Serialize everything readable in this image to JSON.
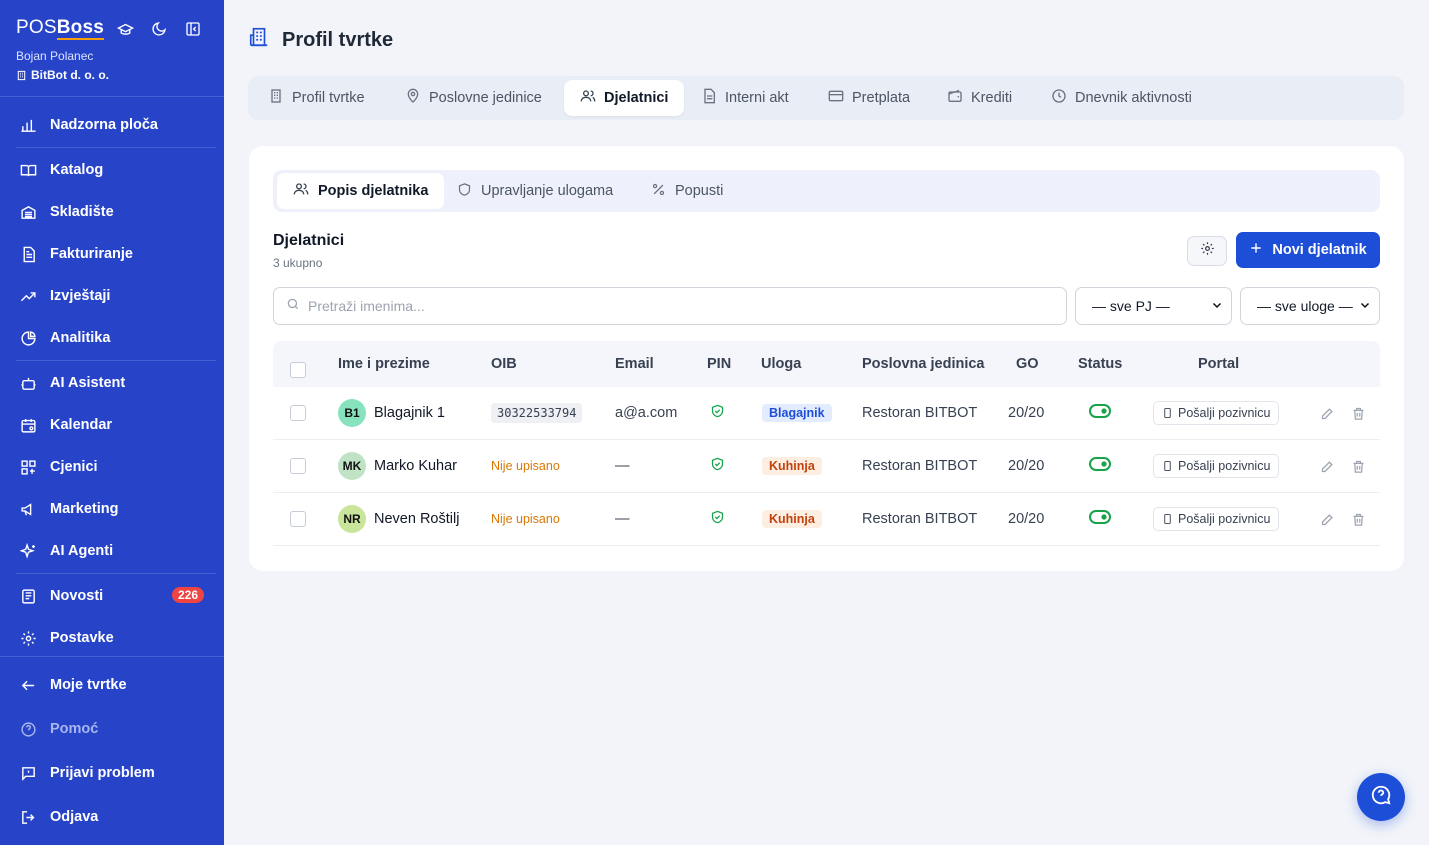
{
  "sidebar": {
    "brand_pos": "POS",
    "brand_boss": "Boss",
    "user_name": "Bojan Polanec",
    "company": "BitBot d. o. o.",
    "items": [
      {
        "label": "Nadzorna ploča",
        "icon": "chart-bars-icon"
      },
      {
        "label": "Katalog",
        "icon": "book-icon"
      },
      {
        "label": "Skladište",
        "icon": "warehouse-icon"
      },
      {
        "label": "Fakturiranje",
        "icon": "invoice-icon"
      },
      {
        "label": "Izvještaji",
        "icon": "trend-icon"
      },
      {
        "label": "Analitika",
        "icon": "pie-icon"
      },
      {
        "label": "AI Asistent",
        "icon": "robot-icon"
      },
      {
        "label": "Kalendar",
        "icon": "calendar-icon"
      },
      {
        "label": "Cjenici",
        "icon": "grid-icon"
      },
      {
        "label": "Marketing",
        "icon": "megaphone-icon"
      },
      {
        "label": "AI Agenti",
        "icon": "sparkles-icon"
      },
      {
        "label": "Novosti",
        "icon": "news-icon",
        "badge": "226"
      },
      {
        "label": "Postavke",
        "icon": "gear-icon"
      },
      {
        "label": "Moje tvrtke",
        "icon": "arrow-left-icon"
      },
      {
        "label": "Pomoć",
        "icon": "help-icon"
      },
      {
        "label": "Prijavi problem",
        "icon": "report-icon"
      },
      {
        "label": "Odjava",
        "icon": "logout-icon"
      }
    ]
  },
  "page": {
    "title": "Profil tvrtke"
  },
  "tabs": [
    {
      "label": "Profil tvrtke"
    },
    {
      "label": "Poslovne jedinice"
    },
    {
      "label": "Djelatnici"
    },
    {
      "label": "Interni akt"
    },
    {
      "label": "Pretplata"
    },
    {
      "label": "Krediti"
    },
    {
      "label": "Dnevnik aktivnosti"
    }
  ],
  "subtabs": [
    {
      "label": "Popis djelatnika"
    },
    {
      "label": "Upravljanje ulogama"
    },
    {
      "label": "Popusti"
    }
  ],
  "section": {
    "title": "Djelatnici",
    "count": "3 ukupno",
    "new_button": "Novi djelatnik"
  },
  "search": {
    "placeholder": "Pretraži imenima..."
  },
  "filters": {
    "unit": "— sve PJ —",
    "role": "— sve uloge —"
  },
  "table": {
    "headers": [
      "Ime i prezime",
      "OIB",
      "Email",
      "PIN",
      "Uloga",
      "Poslovna jedinica",
      "GO",
      "Status",
      "Portal"
    ],
    "rows": [
      {
        "initials": "B1",
        "avatar_color": "#86e3bd",
        "name": "Blagajnik 1",
        "oib": "30322533794",
        "oib_missing": false,
        "email": "a@a.com",
        "role": "Blagajnik",
        "role_style": "blue",
        "unit": "Restoran BITBOT",
        "go": "20/20",
        "invite": "Pošalji pozivnicu"
      },
      {
        "initials": "MK",
        "avatar_color": "#bfe3c4",
        "name": "Marko Kuhar",
        "oib": "Nije upisano",
        "oib_missing": true,
        "email": "—",
        "role": "Kuhinja",
        "role_style": "orange",
        "unit": "Restoran BITBOT",
        "go": "20/20",
        "invite": "Pošalji pozivnicu"
      },
      {
        "initials": "NR",
        "avatar_color": "#c9e59a",
        "name": "Neven Roštilj",
        "oib": "Nije upisano",
        "oib_missing": true,
        "email": "—",
        "role": "Kuhinja",
        "role_style": "orange",
        "unit": "Restoran BITBOT",
        "go": "20/20",
        "invite": "Pošalji pozivnicu"
      }
    ]
  },
  "colors": {
    "sidebar": "#2744c9",
    "primary": "#1d4ed8",
    "badge": "#ef4444",
    "status_on": "#16a34a"
  }
}
